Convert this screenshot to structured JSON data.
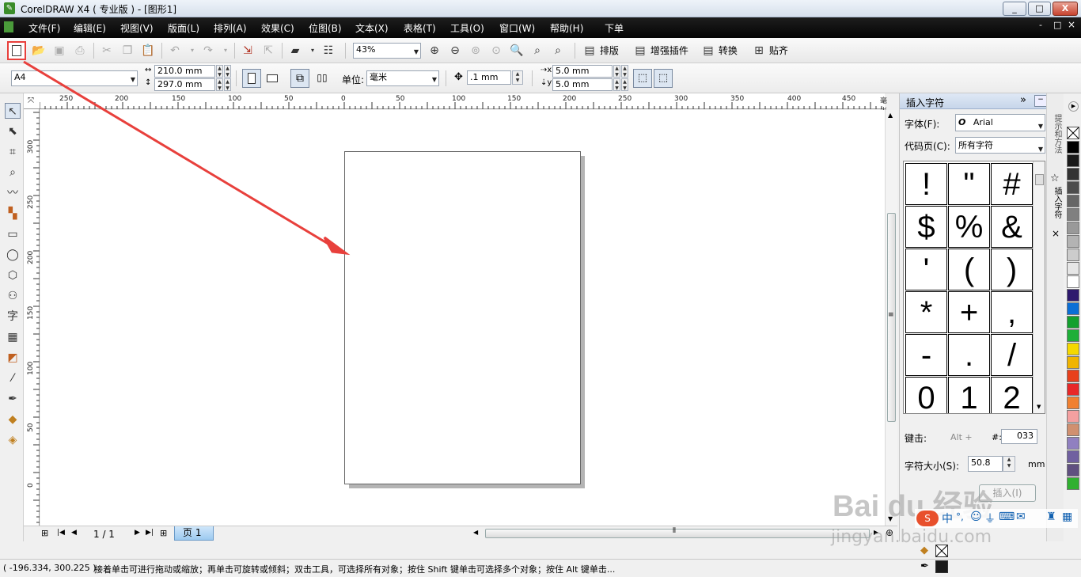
{
  "window": {
    "title": "CorelDRAW X4 ( 专业版 ) - [图形1]",
    "btn_min": "_",
    "btn_max": "□",
    "btn_close": "X",
    "doc_btns": [
      "-",
      "□",
      "×"
    ]
  },
  "menu": [
    "文件(F)",
    "编辑(E)",
    "视图(V)",
    "版面(L)",
    "排列(A)",
    "效果(C)",
    "位图(B)",
    "文本(X)",
    "表格(T)",
    "工具(O)",
    "窗口(W)",
    "帮助(H)",
    "下单"
  ],
  "toolbar": {
    "zoom": "43%",
    "btn_layout": "排版",
    "btn_plugin": "增强插件",
    "btn_convert": "转换",
    "btn_snap": "贴齐"
  },
  "propbar": {
    "paper": "A4",
    "width": "210.0 mm",
    "height": "297.0 mm",
    "units_label": "单位:",
    "units": "毫米",
    "nudge": ".1 mm",
    "dup_x": "5.0 mm",
    "dup_y": "5.0 mm"
  },
  "hruler_labels": [
    "250",
    "200",
    "150",
    "100",
    "50",
    "0",
    "50",
    "100",
    "150",
    "200",
    "250",
    "300",
    "350",
    "400",
    "450",
    "毫米"
  ],
  "vruler_labels": [
    "300",
    "250",
    "200",
    "150",
    "100",
    "50",
    "0"
  ],
  "docker": {
    "title": "插入字符",
    "font_label": "字体(F):",
    "font_value": "Arial",
    "codepage_label": "代码页(C):",
    "codepage_value": "所有字符",
    "glyphs": [
      "!",
      "\"",
      "#",
      "$",
      "%",
      "&",
      "'",
      "(",
      ")",
      "*",
      "+",
      ",",
      "-",
      ".",
      "/",
      "0",
      "1",
      "2"
    ],
    "keystroke_label": "键击:",
    "keystroke_value": "Alt +",
    "hash_label": "#:",
    "hash_value": "033",
    "size_label": "字符大小(S):",
    "size_value": "50.8",
    "size_unit": "mm",
    "insert_button": "插入(I)",
    "tabs": [
      "提示和方法",
      "插入字符"
    ]
  },
  "pagenav": {
    "counter": "1 / 1",
    "tab": "页 1"
  },
  "status": {
    "coords": "( -196.334, 300.225 )",
    "hint": "接着单击可进行拖动或缩放；再单击可旋转或倾斜；双击工具，可选择所有对象；按住 Shift 键单击可选择多个对象；按住 Alt 键单击..."
  },
  "watermark": {
    "brand": "Bai du 经验",
    "url": "jingyan.baidu.com"
  },
  "colors": {
    "accent_red": "#e8403c",
    "menubar": "#0c0c0c",
    "palette": [
      "#000000",
      "#1a1a1a",
      "#333333",
      "#4d4d4d",
      "#666666",
      "#808080",
      "#999999",
      "#b3b3b3",
      "#cccccc",
      "#e6e6e6",
      "#ffffff",
      "#2e1a6e",
      "#0b6fd6",
      "#13a02e",
      "#1eaf38",
      "#f5d800",
      "#f0b400",
      "#e8401c",
      "#e82828",
      "#f08030",
      "#f4a0a0",
      "#d09070",
      "#9080c0",
      "#7060a0",
      "#605080",
      "#30b030"
    ]
  }
}
